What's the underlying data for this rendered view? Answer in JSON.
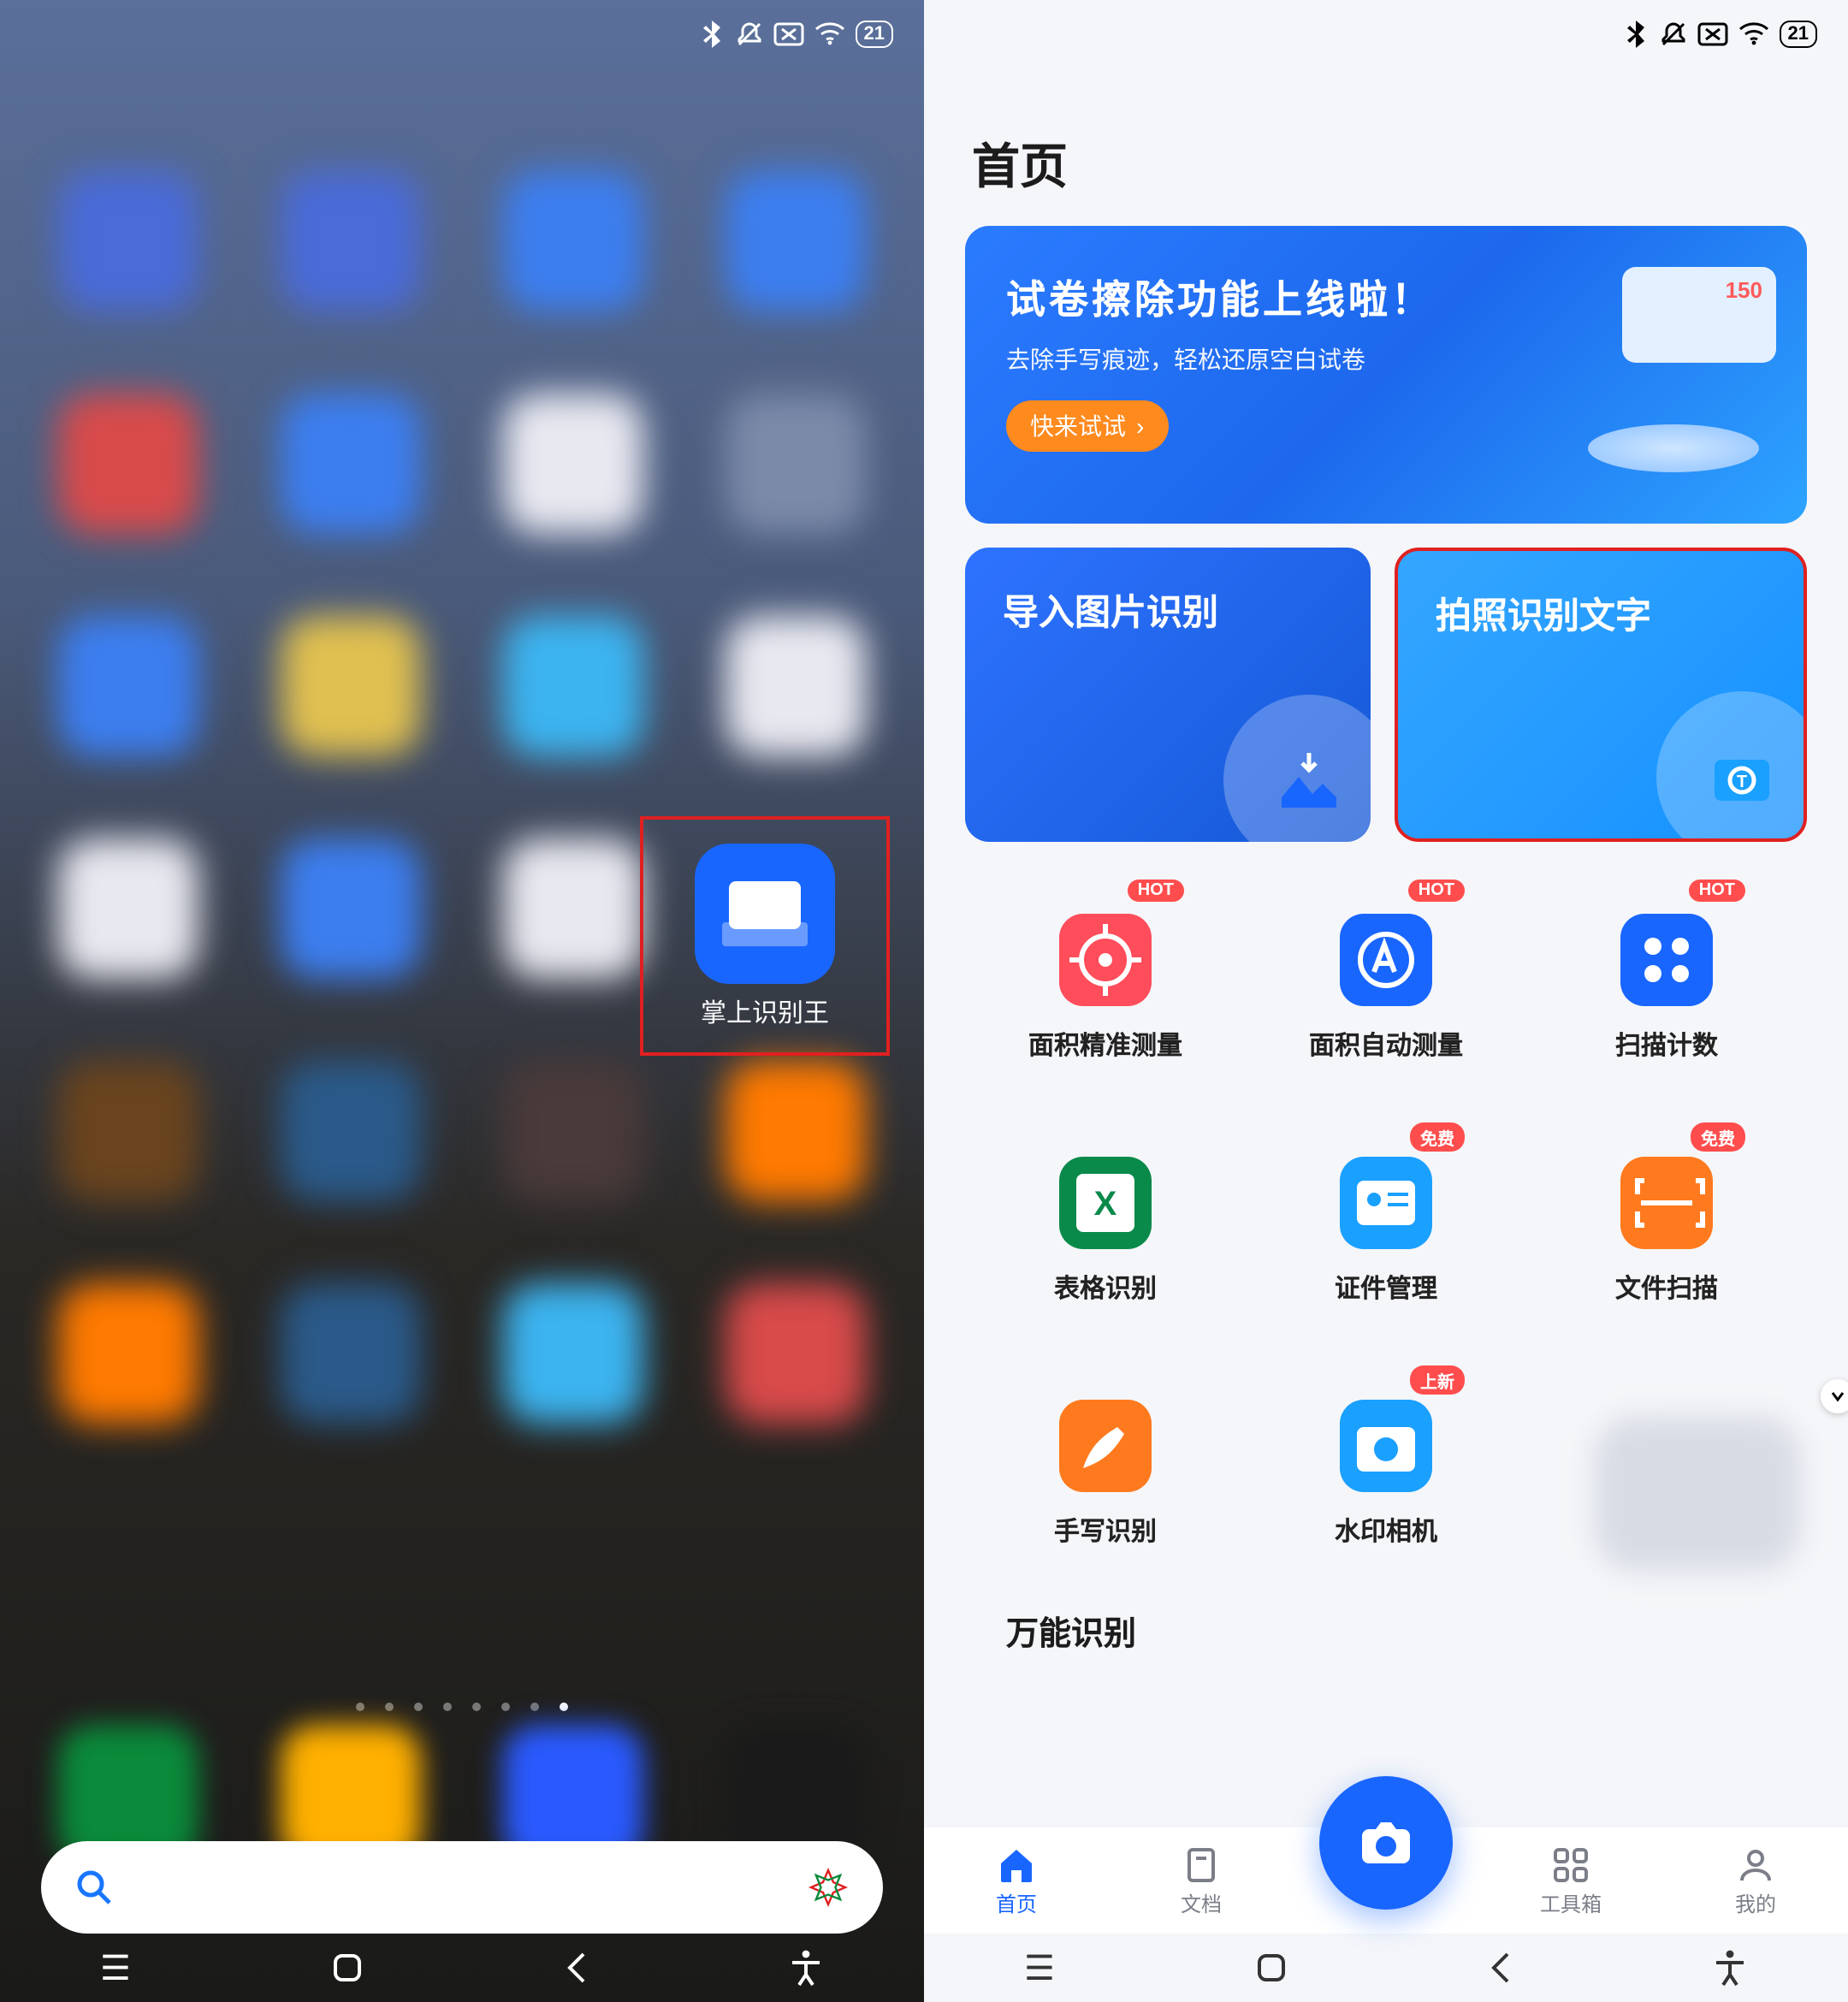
{
  "status": {
    "battery": "21",
    "icons": [
      "bluetooth",
      "mute",
      "no-sim",
      "wifi"
    ]
  },
  "home": {
    "highlighted_app_label": "掌上识别王",
    "page_dots": 8,
    "active_dot": 7,
    "blur_colors": [
      "#4a6bd8",
      "#4a6bd8",
      "#3c7ef0",
      "#3c7ef0",
      "#d94a4a",
      "#3c7ef0",
      "#e8e8f0",
      "#7b8aa8",
      "#3c7ef0",
      "#e0c050",
      "#3cb4f0",
      "#e8e8f0",
      "#e8e8f0",
      "#3c7ef0",
      "#e8e8f0",
      "",
      "#6a441e",
      "#2a5a8a",
      "#4a3a3a",
      "#ff7a00",
      "#ff7a00",
      "#2a5a8a",
      "#3cb4f0",
      "#d94a4a"
    ],
    "dock_colors": [
      "#0a8a3a",
      "#ffb000",
      "#2a5aff",
      "#1a1a1a"
    ]
  },
  "app": {
    "page_title": "首页",
    "banner": {
      "title": "试卷擦除功能上线啦！",
      "subtitle": "去除手写痕迹，轻松还原空白试卷",
      "cta": "快来试试"
    },
    "big_cards": {
      "import": "导入图片识别",
      "camera_ocr": "拍照识别文字"
    },
    "tools": [
      {
        "label": "面积精准测量",
        "color": "#ff4d5b",
        "badge": "HOT",
        "icon": "target"
      },
      {
        "label": "面积自动测量",
        "color": "#1966ff",
        "badge": "HOT",
        "icon": "auto"
      },
      {
        "label": "扫描计数",
        "color": "#1966ff",
        "badge": "HOT",
        "icon": "dots"
      },
      {
        "label": "表格识别",
        "color": "#0a8a4a",
        "badge": "",
        "icon": "excel"
      },
      {
        "label": "证件管理",
        "color": "#1aa0ff",
        "badge": "免费",
        "icon": "idcard"
      },
      {
        "label": "文件扫描",
        "color": "#ff7a1e",
        "badge": "免费",
        "icon": "scan"
      },
      {
        "label": "手写识别",
        "color": "#ff7a1e",
        "badge": "",
        "icon": "write"
      },
      {
        "label": "水印相机",
        "color": "#1aa0ff",
        "badge": "上新",
        "icon": "camera"
      }
    ],
    "section_universal": "万能识别",
    "tabs": [
      {
        "label": "首页",
        "icon": "home",
        "active": true
      },
      {
        "label": "文档",
        "icon": "doc",
        "active": false
      },
      {
        "label": "",
        "icon": "fab",
        "active": false
      },
      {
        "label": "工具箱",
        "icon": "toolbox",
        "active": false
      },
      {
        "label": "我的",
        "icon": "profile",
        "active": false
      }
    ]
  }
}
